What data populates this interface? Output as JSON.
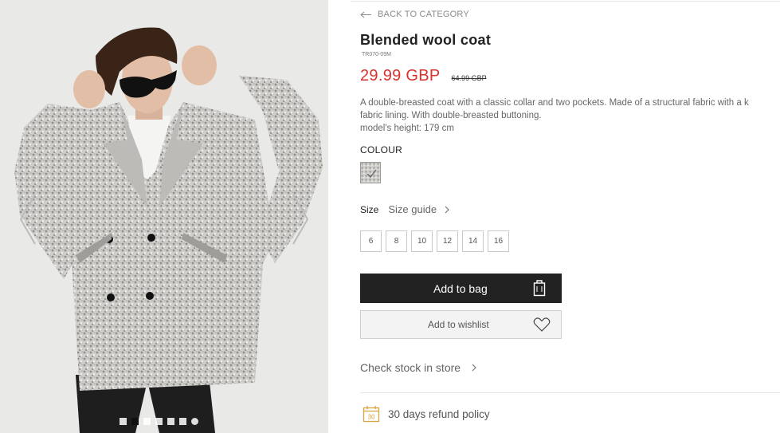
{
  "product": {
    "back_label": "BACK TO CATEGORY",
    "title": "Blended wool coat",
    "sku": "TR070-09M",
    "price": "29.99 GBP",
    "old_price": "64.99 GBP",
    "description": [
      "A double-breasted coat with a classic collar and two pockets. Made of a structural fabric with a k",
      "fabric lining. With double-breasted buttoning.",
      "model's height: 179 cm"
    ],
    "price_color": "#d9312e"
  },
  "colour": {
    "label": "COLOUR",
    "selected_swatch": "grey-boucle"
  },
  "size": {
    "label": "Size",
    "guide_label": "Size guide",
    "options": [
      "6",
      "8",
      "10",
      "12",
      "14",
      "16"
    ]
  },
  "actions": {
    "add_to_bag": "Add to bag",
    "add_to_wishlist": "Add to wishlist",
    "check_stock": "Check stock in store"
  },
  "refund": {
    "label": "30 days refund policy",
    "icon_number": "30"
  },
  "gallery": {
    "dots_total": 7,
    "active_dot": 1
  },
  "icons": {
    "back": "arrow-left-icon",
    "bag": "shopping-bag-icon",
    "wishlist": "heart-icon",
    "chevron": "chevron-right-icon",
    "calendar": "calendar-icon"
  }
}
